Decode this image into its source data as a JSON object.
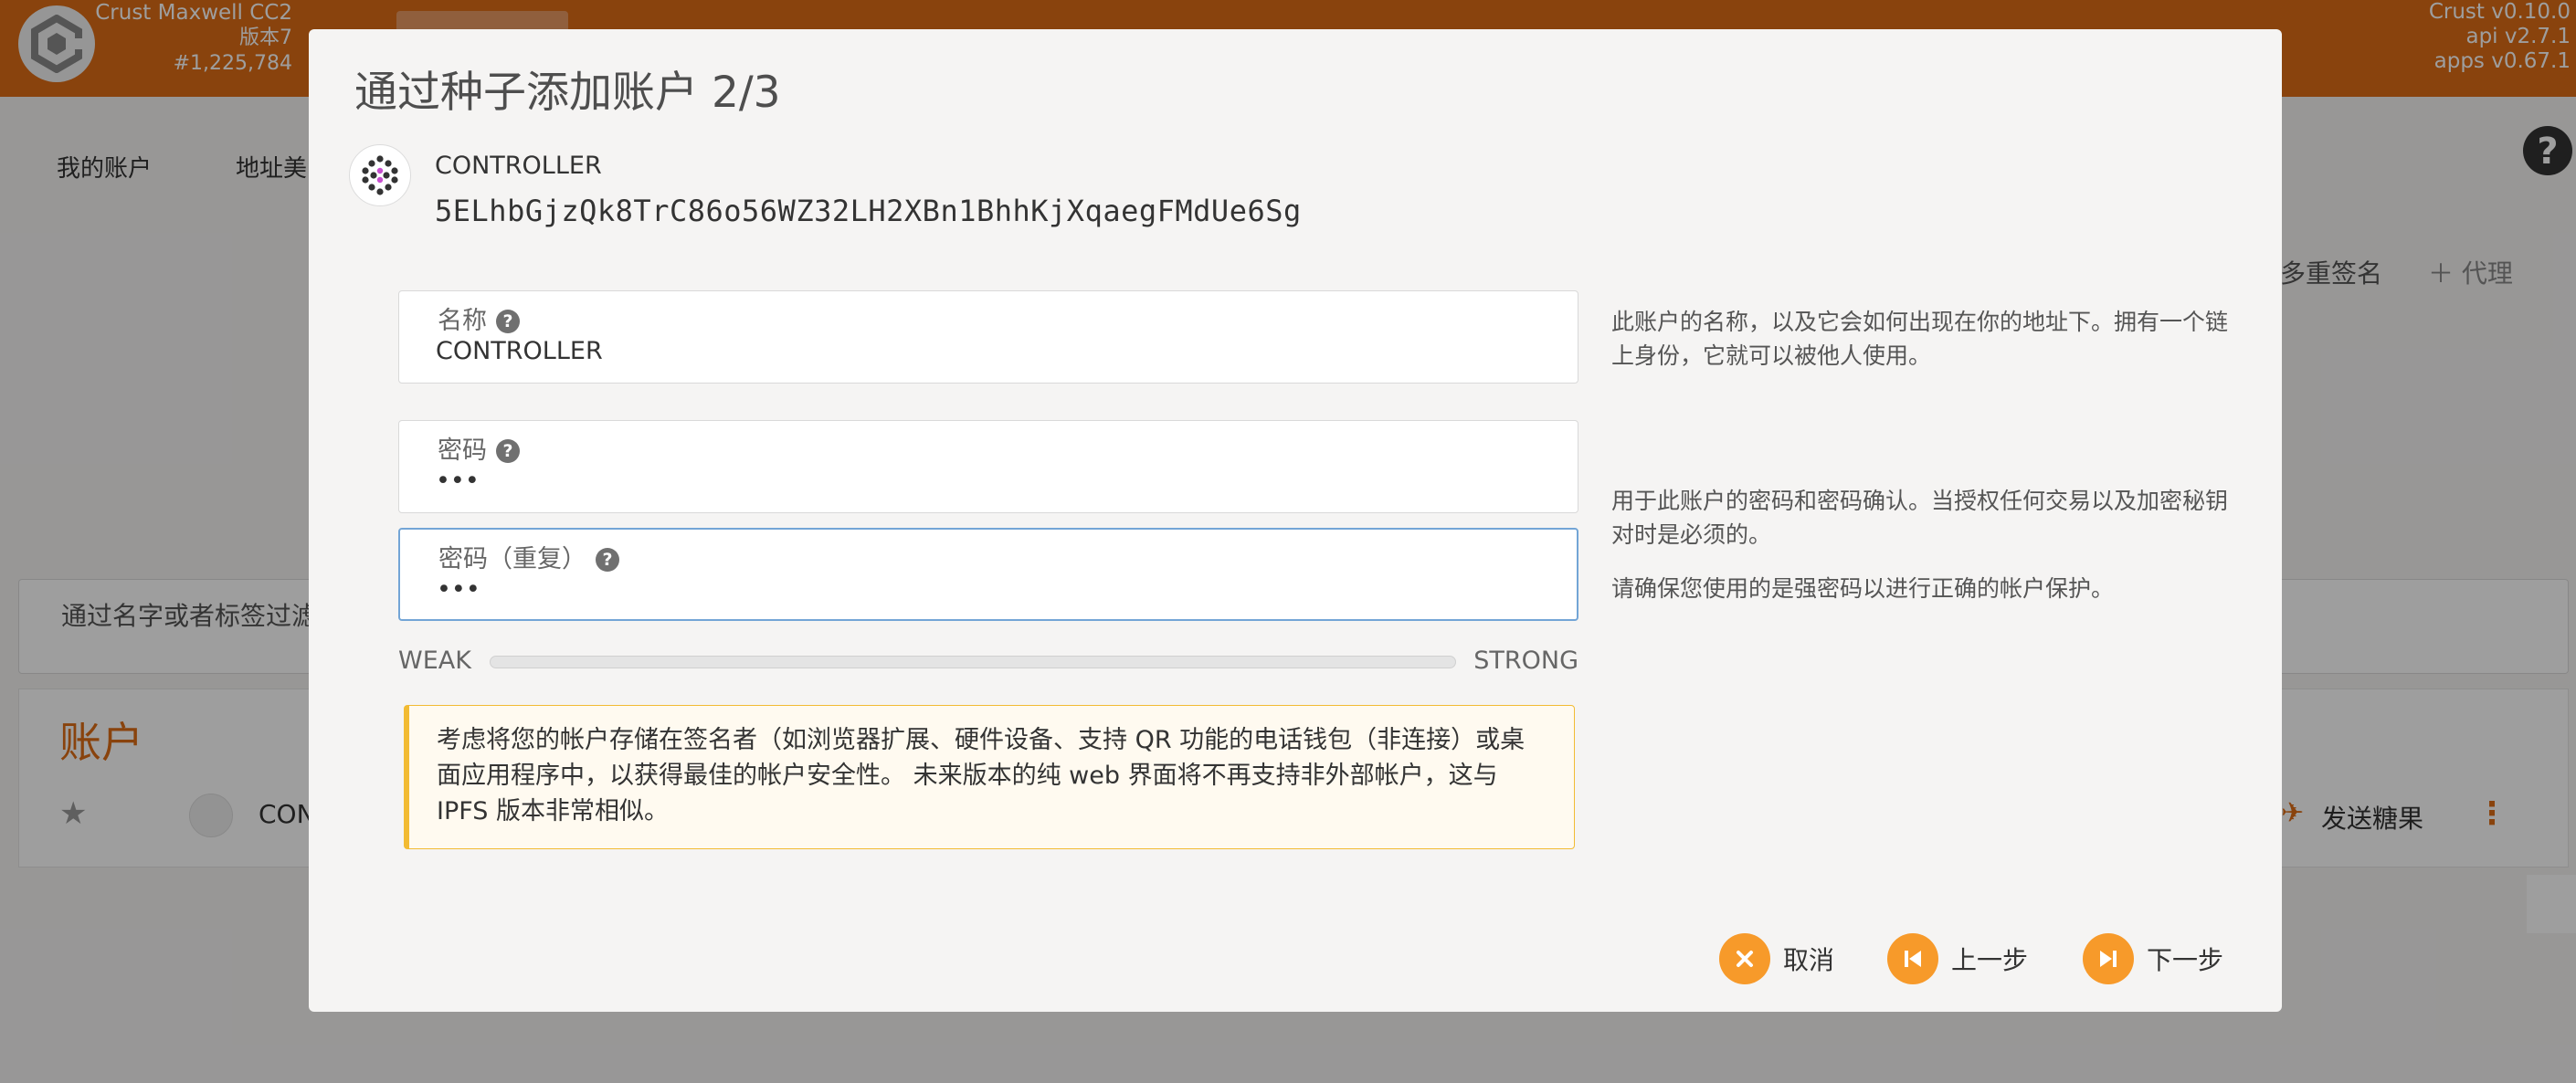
{
  "app": {
    "chain_name": "Crust Maxwell CC2",
    "version_label": "版本7",
    "block": "#1,225,784",
    "crust_version": "Crust v0.10.0",
    "api_version": "api v2.7.1",
    "apps_version": "apps v0.67.1"
  },
  "nav": {
    "tab_accounts": "我的账户",
    "tab_address_book": "地址美"
  },
  "toolbar": {
    "multisig": "多重签名",
    "proxy": "代理"
  },
  "filter": {
    "placeholder": "通过名字或者标签过滤"
  },
  "accounts": {
    "title": "账户",
    "row_name": "CON",
    "send_candy": "发送糖果"
  },
  "modal": {
    "title": "通过种子添加账户 2/3",
    "account_label": "CONTROLLER",
    "account_address": "5ELhbGjzQk8TrC86o56WZ32LH2XBn1BhhKjXqaegFMdUe6Sg",
    "name_field": {
      "label": "名称",
      "value": "CONTROLLER"
    },
    "name_help": "此账户的名称，以及它会如何出现在你的地址下。拥有一个链上身份，它就可以被他人使用。",
    "password_field": {
      "label": "密码",
      "value": "•••"
    },
    "password_repeat_field": {
      "label": "密码（重复）",
      "value": "•••"
    },
    "password_help": "用于此账户的密码和密码确认。当授权任何交易以及加密秘钥对时是必须的。",
    "password_help2": "请确保您使用的是强密码以进行正确的帐户保护。",
    "strength": {
      "weak": "WEAK",
      "strong": "STRONG",
      "level": 0.0
    },
    "warning": "考虑将您的帐户存储在签名者（如浏览器扩展、硬件设备、支持 QR 功能的电话钱包（非连接）或桌面应用程序中，以获得最佳的帐户安全性。 未来版本的纯 web 界面将不再支持非外部帐户，这与 IPFS 版本非常相似。",
    "buttons": {
      "cancel": "取消",
      "prev": "上一步",
      "next": "下一步"
    }
  },
  "colors": {
    "brand": "#dd6d16",
    "button": "#f79a2a",
    "warning_border": "#f2bb33",
    "focus_border": "#73a5d6"
  },
  "icons": {
    "logo": "crust-logo-icon",
    "help": "question-circle-icon",
    "cancel": "x-circle-icon",
    "prev": "step-backward-icon",
    "next": "step-forward-icon"
  }
}
